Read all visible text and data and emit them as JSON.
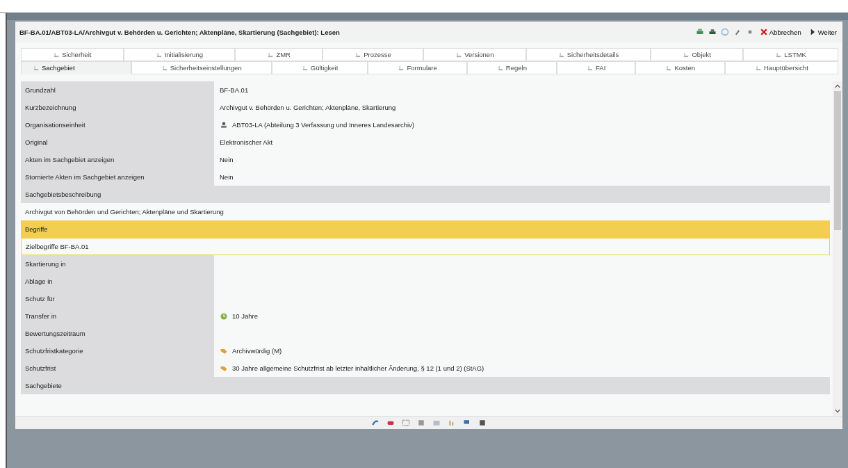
{
  "window": {
    "title": "BF-BA.01/ABT03-LA/Archivgut v. Behörden u. Gerichten; Aktenpläne, Skartierung (Sachgebiet): Lesen"
  },
  "toolbar": {
    "buttons": [
      {
        "kind": "cancel",
        "label": "Abbrechen"
      },
      {
        "kind": "next",
        "label": "Weiter"
      }
    ]
  },
  "tab_rows": [
    [
      {
        "label": "Sicherheit",
        "selected": false
      },
      {
        "label": "Initialisierung",
        "selected": false
      },
      {
        "label": "ZMR",
        "selected": false
      },
      {
        "label": "Prozesse",
        "selected": false
      },
      {
        "label": "Versionen",
        "selected": false
      },
      {
        "label": "Sicherheitsdetails",
        "selected": false
      },
      {
        "label": "Objekt",
        "selected": false
      },
      {
        "label": "LSTMK",
        "selected": false
      }
    ],
    [
      {
        "label": "Sachgebiet",
        "selected": true
      },
      {
        "label": "Sicherheitseinstellungen",
        "selected": false
      },
      {
        "label": "Gültigkeit",
        "selected": false
      },
      {
        "label": "Formulare",
        "selected": false
      },
      {
        "label": "Regeln",
        "selected": false
      },
      {
        "label": "FAI",
        "selected": false
      },
      {
        "label": "Kosten",
        "selected": false
      },
      {
        "label": "Hauptübersicht",
        "selected": false
      }
    ]
  ],
  "rows": [
    {
      "kind": "field",
      "label": "Grundzahl",
      "value": "BF-BA.01"
    },
    {
      "kind": "field",
      "label": "Kurzbezeichnung",
      "value": "Archivgut v. Behörden u. Gerichten; Aktenpläne, Skartierung"
    },
    {
      "kind": "unit",
      "label": "Organisationseinheit",
      "value": "ABT03-LA (Abteilung 3 Verfassung und Inneres Landesarchiv)"
    },
    {
      "kind": "field",
      "label": "Original",
      "value": "Elektronischer Akt"
    },
    {
      "kind": "field",
      "label": "Akten im Sachgebiet anzeigen",
      "value": "Nein"
    },
    {
      "kind": "field",
      "label": "Stornierte Akten im Sachgebiet anzeigen",
      "value": "Nein"
    },
    {
      "kind": "section",
      "label": "Sachgebietsbeschreibung",
      "selected": false
    },
    {
      "kind": "text",
      "label": "Archivgut von Behörden und Gerichten; Aktenpläne und Skartierung",
      "selected": false
    },
    {
      "kind": "section",
      "label": "Begriffe",
      "selected": true
    },
    {
      "kind": "text",
      "label": "Zielbegriffe BF-BA.01",
      "selected": true
    },
    {
      "kind": "field",
      "label": "Skartierung in"
    },
    {
      "kind": "field",
      "label": "Ablage in"
    },
    {
      "kind": "field",
      "label": "Schutz für"
    },
    {
      "kind": "period",
      "label": "Transfer in",
      "value": "10 Jahre"
    },
    {
      "kind": "field",
      "label": "Bewertungszeitraum"
    },
    {
      "kind": "category",
      "label": "Schutzfristkategorie",
      "value": "Archivwürdig (M)"
    },
    {
      "kind": "category",
      "label": "Schutzfrist",
      "value": "30 Jahre allgemeine Schutzfrist ab letzter inhaltlicher Änderung, § 12 (1 und 2) (StAG)"
    },
    {
      "kind": "section",
      "label": "Sachgebiete",
      "selected": false
    }
  ]
}
